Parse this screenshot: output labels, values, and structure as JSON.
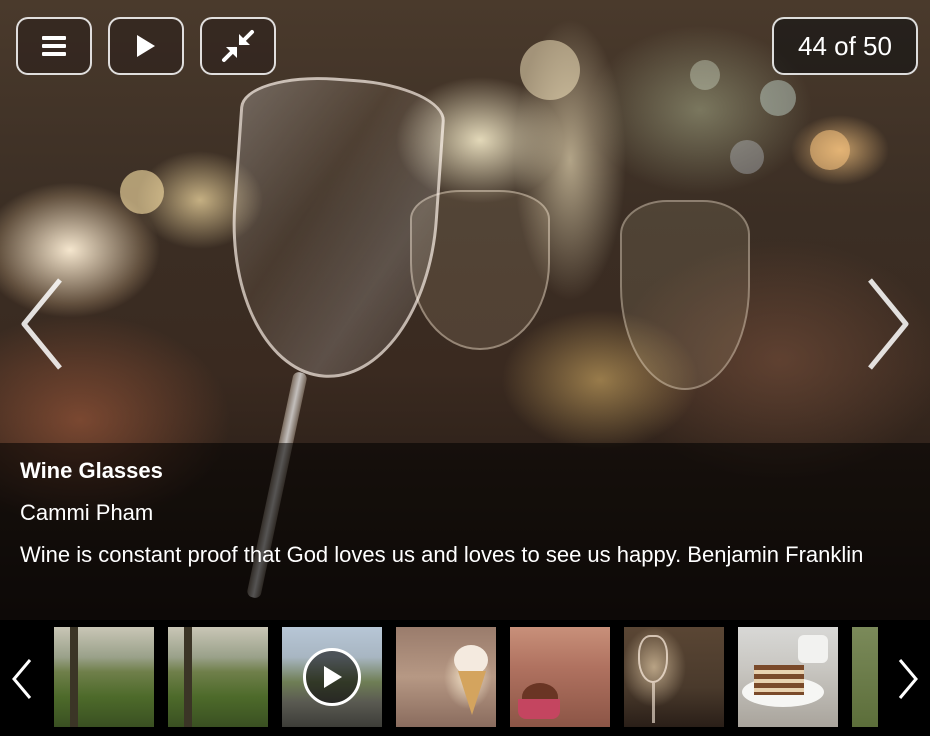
{
  "toolbar": {
    "menu_icon": "menu-icon",
    "play_icon": "play-icon",
    "collapse_icon": "collapse-icon",
    "counter": "44 of 50"
  },
  "photo": {
    "title": "Wine Glasses",
    "author": "Cammi Pham",
    "description": "Wine is constant proof that God loves us and loves to see us happy. Benjamin Franklin"
  },
  "filmstrip": {
    "thumbnails": [
      {
        "subject": "garden-field"
      },
      {
        "subject": "garden-field"
      },
      {
        "subject": "street-video",
        "is_video": true
      },
      {
        "subject": "ice-cream-cone"
      },
      {
        "subject": "cupcake"
      },
      {
        "subject": "wine-glasses",
        "selected": true
      },
      {
        "subject": "cake-slice"
      },
      {
        "subject": "plant"
      }
    ]
  },
  "colors": {
    "overlay": "#000000",
    "text": "#ffffff"
  }
}
